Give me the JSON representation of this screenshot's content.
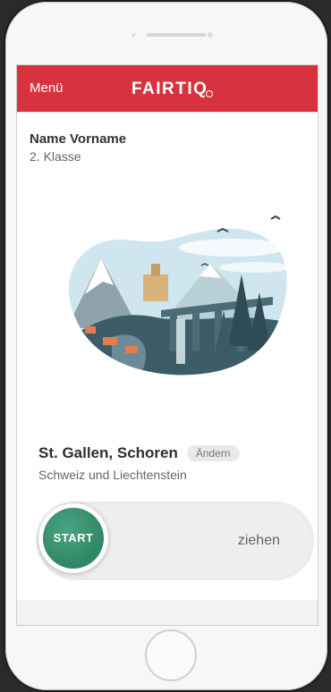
{
  "header": {
    "menu_label": "Menü",
    "brand_name": "FAIRTIQ"
  },
  "user": {
    "name": "Name Vorname",
    "travel_class": "2. Klasse"
  },
  "location": {
    "name": "St. Gallen, Schoren",
    "change_label": "Ändern",
    "region": "Schweiz und Liechtenstein"
  },
  "slider": {
    "start_label": "START",
    "hint": "ziehen"
  },
  "colors": {
    "brand_red": "#d8323f",
    "start_green": "#2f8664",
    "illustration_teal": "#3c5c68",
    "illustration_sky": "#cfe6ee"
  },
  "icons": {
    "home_button": "circle-home-button"
  }
}
